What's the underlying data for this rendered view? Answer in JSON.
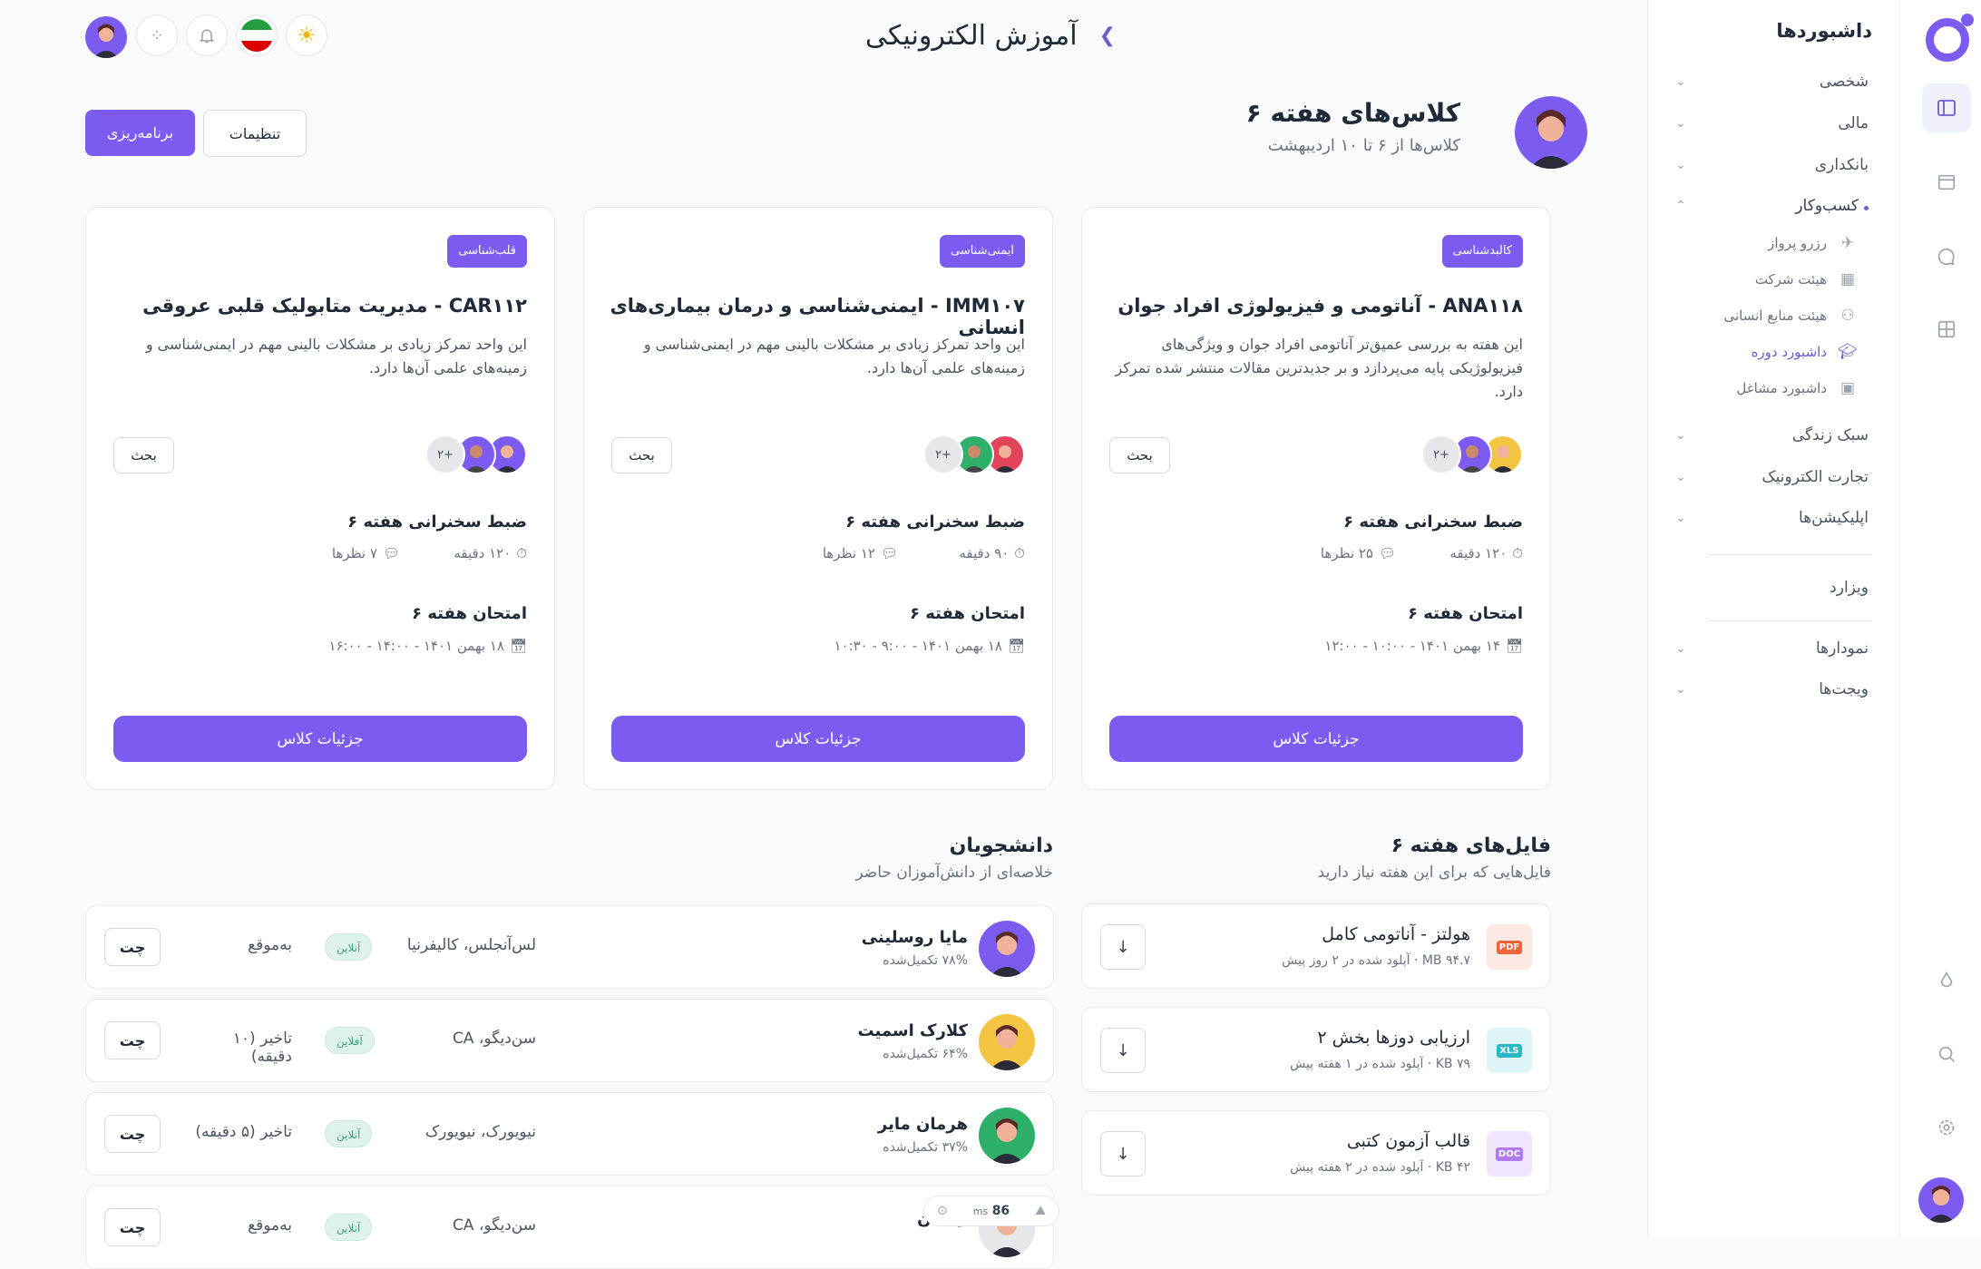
{
  "app": {
    "title": "آموزش الکترونیکی"
  },
  "header": {
    "page_title": "کلاس‌های هفته ۶",
    "subtitle": "کلاس‌ها از ۶ تا ۱۰ اردیبهشت",
    "settings_label": "تنظیمات",
    "schedule_label": "برنامه‌ریزی"
  },
  "sidebar": {
    "heading": "داشبوردها",
    "items": [
      {
        "label": "شخصی"
      },
      {
        "label": "مالی"
      },
      {
        "label": "بانکداری"
      },
      {
        "label": "کسب‌وکار"
      }
    ],
    "subitems": [
      {
        "label": "رزرو پرواز",
        "icon": "plane-icon"
      },
      {
        "label": "هیئت شرکت",
        "icon": "building-icon"
      },
      {
        "label": "هیئت منابع انسانی",
        "icon": "users-icon"
      },
      {
        "label": "داشبورد دوره",
        "icon": "graduation-cap-icon"
      },
      {
        "label": "داشبورد مشاغل",
        "icon": "briefcase-icon"
      }
    ],
    "items2": [
      {
        "label": "سبک زندگی"
      },
      {
        "label": "تجارت الکترونیک"
      },
      {
        "label": "اپلیکیشن‌ها"
      }
    ],
    "wizard": "ویزارد",
    "items3": [
      {
        "label": "نمودارها"
      },
      {
        "label": "ویجت‌ها"
      }
    ]
  },
  "classes": [
    {
      "tag": "کالبدشناسی",
      "title": "ANA۱۱۸ - آناتومی و فیزیولوژی افراد جوان",
      "desc1": "این هفته به بررسی عمیق‌تر آناتومی افراد جوان و ویژگی‌های",
      "desc2": "فیزیولوژیکی پایه می‌پردازد و بر جدیدترین مقالات منتشر شده تمرکز",
      "desc3": "دارد.",
      "more": "۲+",
      "discuss": "بحث",
      "lecture": "ضبط سخنرانی هفته ۶",
      "duration": "۱۲۰ دقیقه",
      "comments": "۲۵ نظرها",
      "exam": "امتحان هفته ۶",
      "exam_time": "۱۴ بهمن ۱۴۰۱ - ۱۰:۰۰ - ۱۲:۰۰",
      "details": "جزئیات کلاس"
    },
    {
      "tag": "ایمنی‌شناسی",
      "title": "IMM۱۰۷ - ایمنی‌شناسی و درمان بیماری‌های انسانی",
      "desc1": "این واحد تمرکز زیادی بر مشکلات بالینی مهم در ایمنی‌شناسی و",
      "desc2": "زمینه‌های علمی آن‌ها دارد.",
      "desc3": "",
      "more": "۲+",
      "discuss": "بحث",
      "lecture": "ضبط سخنرانی هفته ۶",
      "duration": "۹۰ دقیقه",
      "comments": "۱۲ نظرها",
      "exam": "امتحان هفته ۶",
      "exam_time": "۱۸ بهمن ۱۴۰۱ - ۹:۰۰ - ۱۰:۳۰",
      "details": "جزئیات کلاس"
    },
    {
      "tag": "قلب‌شناسی",
      "title": "CAR۱۱۲ - مدیریت متابولیک قلبی عروقی",
      "desc1": "این واحد تمرکز زیادی بر مشکلات بالینی مهم در ایمنی‌شناسی و",
      "desc2": "زمینه‌های علمی آن‌ها دارد.",
      "desc3": "",
      "more": "۲+",
      "discuss": "بحث",
      "lecture": "ضبط سخنرانی هفته ۶",
      "duration": "۱۲۰ دقیقه",
      "comments": "۷ نظرها",
      "exam": "امتحان هفته ۶",
      "exam_time": "۱۸ بهمن ۱۴۰۱ - ۱۴:۰۰ - ۱۶:۰۰",
      "details": "جزئیات کلاس"
    }
  ],
  "files": {
    "title": "فایل‌های هفته ۶",
    "subtitle": "فایل‌هایی که برای این هفته نیاز دارید",
    "items": [
      {
        "name": "هولتز - آناتومی کامل",
        "meta": "۹۴.۷ MB · آپلود شده در ۲ روز پیش",
        "type": "PDF",
        "color": "#f0643c",
        "bg": "#fde9e3"
      },
      {
        "name": "ارزیابی دوزها بخش ۲",
        "meta": "۷۹ KB · آپلود شده در ۱ هفته پیش",
        "type": "XLS",
        "color": "#28b8c8",
        "bg": "#dff5f7"
      },
      {
        "name": "قالب آزمون کتبی",
        "meta": "۴۲ KB · آپلود شده در ۲ هفته پیش",
        "type": "DOC",
        "color": "#b07af0",
        "bg": "#efe5fd"
      }
    ]
  },
  "students": {
    "title": "دانشجویان",
    "subtitle": "خلاصه‌ای از دانش‌آموزان حاضر",
    "items": [
      {
        "name": "مایا روسلینی",
        "progress": "۷۸% تکمیل‌شده",
        "location": "لس‌آنجلس، کالیفرنیا",
        "status": "آنلاین",
        "punctuality": "به‌موقع",
        "chat": "چت"
      },
      {
        "name": "کلارک اسمیت",
        "progress": "۶۴% تکمیل‌شده",
        "location": "سن‌دیگو، CA",
        "status": "آفلاین",
        "punctuality": "تاخیر (۱۰ دقیقه)",
        "chat": "چت"
      },
      {
        "name": "هرمان مایر",
        "progress": "۳۷% تکمیل‌شده",
        "location": "نیویورک، نیویورک",
        "status": "آنلاین",
        "punctuality": "تاخیر (۵ دقیقه)",
        "chat": "چت"
      },
      {
        "name": "ریکمن",
        "progress": "",
        "location": "سن‌دیگو، CA",
        "status": "آنلاین",
        "punctuality": "به‌موقع",
        "chat": "چت"
      }
    ]
  },
  "perf": {
    "value": "86",
    "unit": "ms"
  }
}
